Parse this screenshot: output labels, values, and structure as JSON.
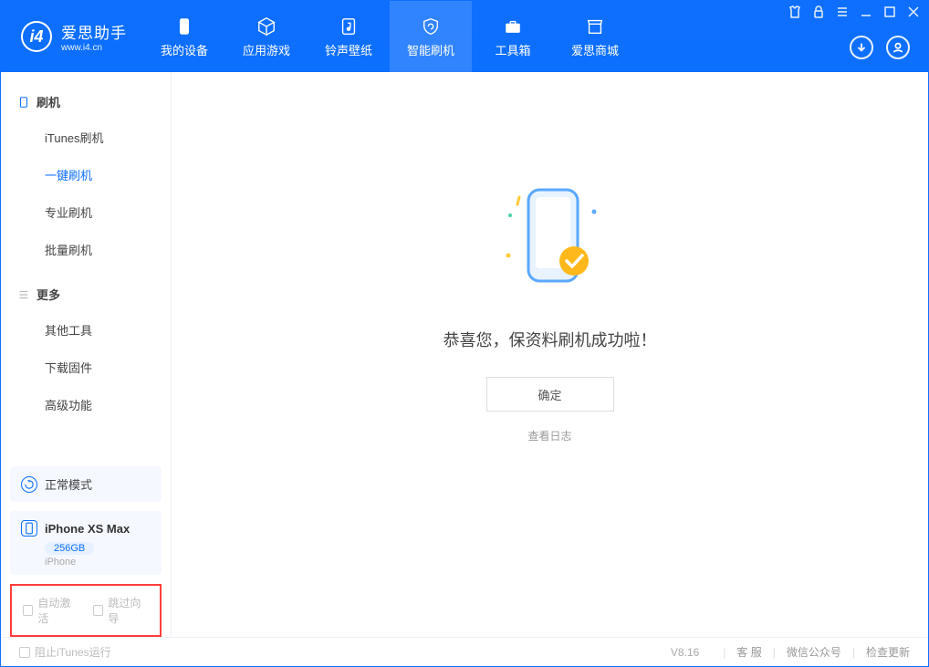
{
  "app": {
    "title": "爱思助手",
    "url": "www.i4.cn"
  },
  "tabs": {
    "device": "我的设备",
    "apps": "应用游戏",
    "ring": "铃声壁纸",
    "flash": "智能刷机",
    "tools": "工具箱",
    "store": "爱思商城"
  },
  "sidebar": {
    "group_flash": "刷机",
    "itunes_flash": "iTunes刷机",
    "onekey_flash": "一键刷机",
    "pro_flash": "专业刷机",
    "batch_flash": "批量刷机",
    "group_more": "更多",
    "other_tools": "其他工具",
    "download_fw": "下载固件",
    "advanced": "高级功能"
  },
  "status": {
    "mode": "正常模式"
  },
  "device": {
    "name": "iPhone XS Max",
    "capacity": "256GB",
    "type": "iPhone"
  },
  "options": {
    "auto_activate": "自动激活",
    "skip_guide": "跳过向导"
  },
  "main": {
    "success": "恭喜您，保资料刷机成功啦！",
    "ok": "确定",
    "view_log": "查看日志"
  },
  "footer": {
    "block_itunes": "阻止iTunes运行",
    "version": "V8.16",
    "support": "客 服",
    "wechat": "微信公众号",
    "update": "检查更新"
  }
}
